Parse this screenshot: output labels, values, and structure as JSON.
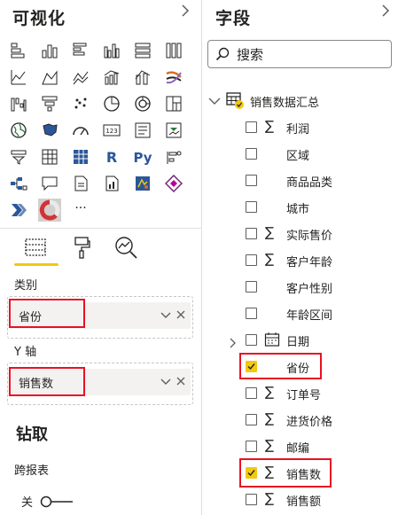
{
  "viz_pane": {
    "title": "可视化",
    "collapse_icon": "chevron-right-icon",
    "visual_icons": [
      "stacked-bar-chart-icon",
      "stacked-column-chart-icon",
      "clustered-bar-chart-icon",
      "clustered-column-chart-icon",
      "100-stacked-bar-chart-icon",
      "100-stacked-column-chart-icon",
      "line-chart-icon",
      "area-chart-icon",
      "stacked-area-chart-icon",
      "line-clustered-column-chart-icon",
      "line-stacked-column-chart-icon",
      "ribbon-chart-icon",
      "waterfall-chart-icon",
      "funnel-icon",
      "scatter-chart-icon",
      "pie-chart-icon",
      "donut-chart-icon",
      "treemap-icon",
      "map-icon",
      "filled-map-icon",
      "gauge-icon",
      "card-icon",
      "multi-row-card-icon",
      "kpi-icon",
      "slicer-icon",
      "table-icon",
      "matrix-icon",
      "r-visual-icon",
      "python-visual-icon",
      "key-influencers-icon",
      "decomposition-tree-icon",
      "qa-icon",
      "smart-narrative-icon",
      "paginated-report-icon",
      "arcgis-map-icon",
      "power-apps-icon",
      "power-automate-icon",
      "custom-donut-visual-icon",
      "more-icon"
    ],
    "more_label": "···",
    "tabs": [
      "fields-tab-icon",
      "format-tab-icon",
      "analytics-tab-icon"
    ],
    "category_label": "类别",
    "category_value": "省份",
    "yaxis_label": "Y 轴",
    "yaxis_value": "销售数",
    "drill_title": "钻取",
    "cross_report_label": "跨报表",
    "toggle_label": "关"
  },
  "fields_pane": {
    "title": "字段",
    "collapse_icon": "chevron-right-icon",
    "search_placeholder": "搜索",
    "table_name": "销售数据汇总",
    "fields": [
      {
        "name": "利润",
        "sigma": true,
        "checked": false
      },
      {
        "name": "区域",
        "sigma": false,
        "checked": false
      },
      {
        "name": "商品品类",
        "sigma": false,
        "checked": false
      },
      {
        "name": "城市",
        "sigma": false,
        "checked": false
      },
      {
        "name": "实际售价",
        "sigma": true,
        "checked": false
      },
      {
        "name": "客户年龄",
        "sigma": true,
        "checked": false
      },
      {
        "name": "客户性别",
        "sigma": false,
        "checked": false
      },
      {
        "name": "年龄区间",
        "sigma": false,
        "checked": false
      },
      {
        "name": "日期",
        "sigma": false,
        "checked": false,
        "calendar": true,
        "expandable": true
      },
      {
        "name": "省份",
        "sigma": false,
        "checked": true
      },
      {
        "name": "订单号",
        "sigma": true,
        "checked": false
      },
      {
        "name": "进货价格",
        "sigma": true,
        "checked": false
      },
      {
        "name": "邮编",
        "sigma": true,
        "checked": false
      },
      {
        "name": "销售数",
        "sigma": true,
        "checked": true
      },
      {
        "name": "销售额",
        "sigma": true,
        "checked": false
      }
    ],
    "sigma_glyph": "∑"
  },
  "colors": {
    "accent": "#f2c811",
    "highlight": "#e81123",
    "icon": "#252423"
  }
}
